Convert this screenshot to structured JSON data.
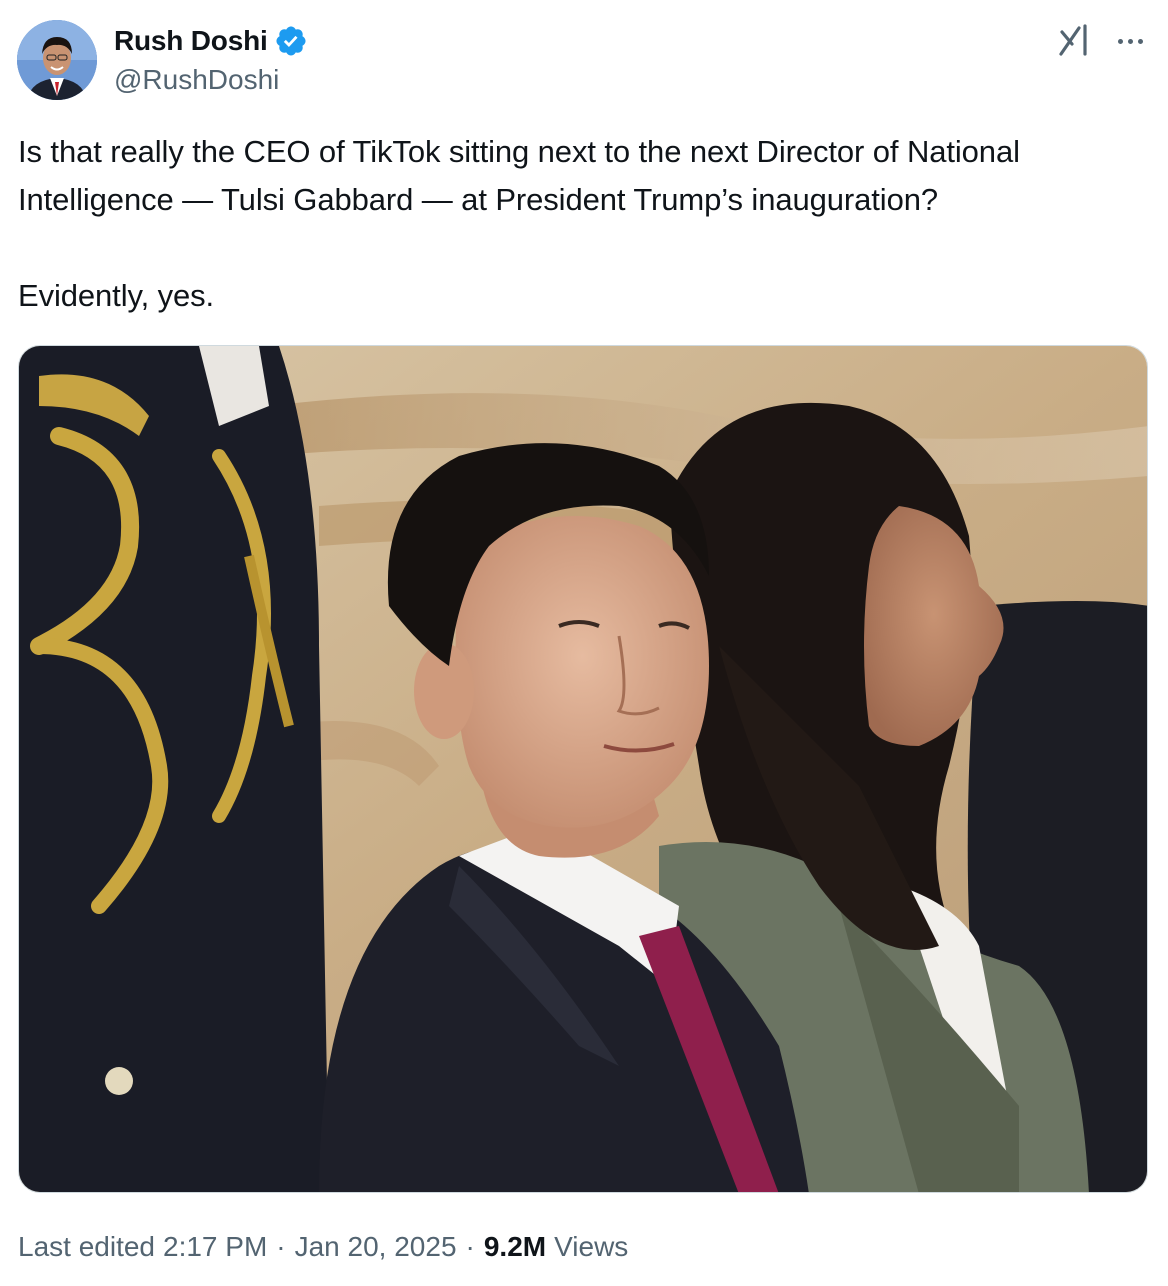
{
  "author": {
    "display_name": "Rush Doshi",
    "handle": "@RushDoshi",
    "verified": true,
    "avatar_icon": "profile-photo"
  },
  "header_icons": {
    "grok": "grok-icon",
    "more": "more-icon"
  },
  "tweet": {
    "paragraph_1": "Is that really the CEO of TikTok sitting next to the next Director of National Intelligence — Tulsi Gabbard — at President Trump’s inauguration?",
    "paragraph_2": "Evidently, yes."
  },
  "media": {
    "type": "photo",
    "content": "tweet-photo"
  },
  "meta": {
    "edited_label": "Last edited",
    "time": "2:17 PM",
    "separator": "·",
    "date": "Jan 20, 2025",
    "views_count": "9.2M",
    "views_label": "Views"
  },
  "colors": {
    "verified_blue": "#1d9bf0",
    "secondary_text": "#536471",
    "primary_text": "#0f1419"
  }
}
